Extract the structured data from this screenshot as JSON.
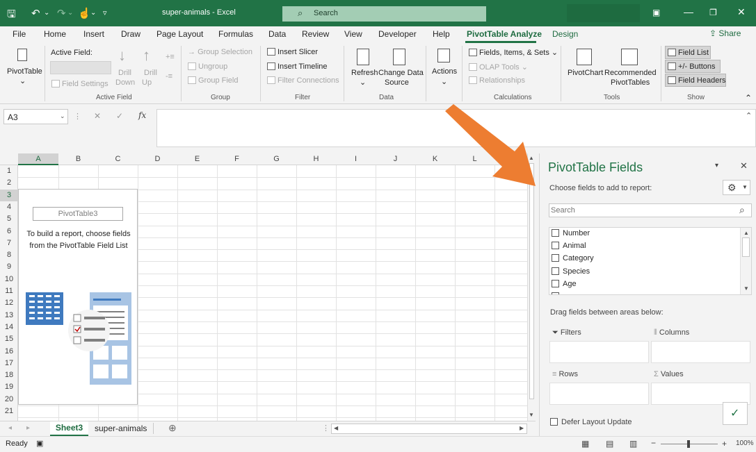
{
  "titlebar": {
    "title": "super-animals  -  Excel",
    "search_label": "Search",
    "min_icon": "minimize-icon",
    "accent_color": "#217346"
  },
  "tabs": [
    {
      "label": "File"
    },
    {
      "label": "Home"
    },
    {
      "label": "Insert"
    },
    {
      "label": "Draw"
    },
    {
      "label": "Page Layout"
    },
    {
      "label": "Formulas"
    },
    {
      "label": "Data"
    },
    {
      "label": "Review"
    },
    {
      "label": "View"
    },
    {
      "label": "Developer"
    },
    {
      "label": "Help"
    },
    {
      "label": "PivotTable Analyze"
    },
    {
      "label": "Design"
    }
  ],
  "share_label": "Share",
  "ribbon": {
    "pivottable": "PivotTable",
    "active_field": "Active Field:",
    "field_settings": "Field Settings",
    "drill_down": [
      "Drill",
      "Down"
    ],
    "drill_up": [
      "Drill",
      "Up"
    ],
    "group_selection": "Group Selection",
    "ungroup": "Ungroup",
    "group_field": "Group Field",
    "insert_slicer": "Insert Slicer",
    "insert_timeline": "Insert Timeline",
    "filter_connections": "Filter Connections",
    "refresh": "Refresh",
    "change_data_source": [
      "Change Data",
      "Source"
    ],
    "actions": "Actions",
    "fields_items_sets": "Fields, Items, & Sets",
    "olap_tools": "OLAP Tools",
    "relationships": "Relationships",
    "pivotchart": "PivotChart",
    "recommended": [
      "Recommended",
      "PivotTables"
    ],
    "field_list": "Field List",
    "buttons": "+/- Buttons",
    "field_headers": "Field Headers",
    "groups": {
      "active_field": "Active Field",
      "group": "Group",
      "filter": "Filter",
      "data": "Data",
      "calculations": "Calculations",
      "tools": "Tools",
      "show": "Show"
    }
  },
  "formula_bar": {
    "name_box": "A3",
    "cancel": "✕",
    "enter": "✓",
    "fx": "fx",
    "formula": ""
  },
  "columns": [
    "A",
    "B",
    "C",
    "D",
    "E",
    "F",
    "G",
    "H",
    "I",
    "J",
    "K",
    "L"
  ],
  "rows": [
    "1",
    "2",
    "3",
    "4",
    "5",
    "6",
    "7",
    "8",
    "9",
    "10",
    "11",
    "12",
    "13",
    "14",
    "15",
    "16",
    "17",
    "18",
    "19",
    "20",
    "21"
  ],
  "pivot_placeholder": {
    "name": "PivotTable3",
    "message": "To build a report, choose fields from the PivotTable Field List"
  },
  "sheets": [
    "Sheet3",
    "super-animals"
  ],
  "status": {
    "ready": "Ready",
    "zoom": "100%"
  },
  "pane": {
    "title": "PivotTable Fields",
    "hint": "Choose fields to add to report:",
    "search_placeholder": "Search",
    "fields": [
      "Number",
      "Animal",
      "Category",
      "Species",
      "Age"
    ],
    "drag_hint": "Drag fields between areas below:",
    "areas": {
      "filters": "Filters",
      "columns": "Columns",
      "rows": "Rows",
      "values": "Values"
    },
    "defer": "Defer Layout Update"
  },
  "annotation_arrow_color": "#ed7d31"
}
